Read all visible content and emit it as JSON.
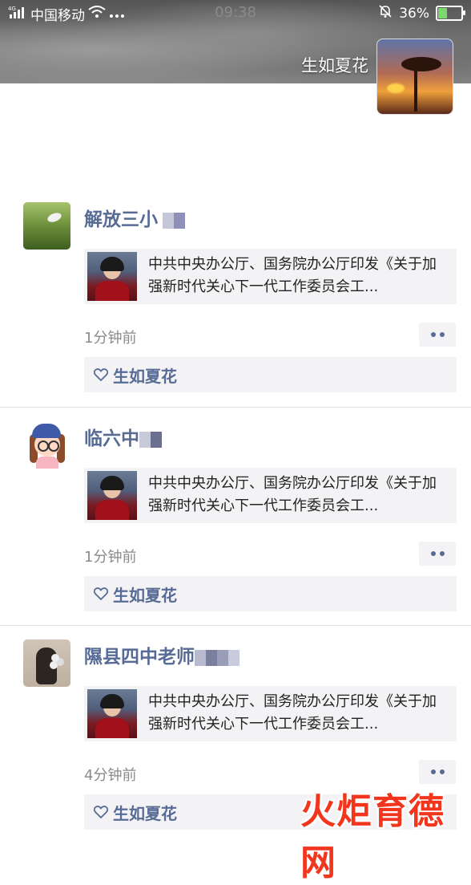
{
  "status_bar": {
    "signal_label": "4G",
    "carrier": "中国移动",
    "time": "09:38",
    "battery": "36%",
    "battery_level": 0.36,
    "icons": [
      "signal-icon",
      "wifi-icon",
      "more-dots-icon",
      "mute-bell-icon",
      "battery-icon"
    ]
  },
  "profile": {
    "name": "生如夏花"
  },
  "feed": [
    {
      "user": "解放三小",
      "share_title": "中共中央办公厅、国务院办公厅印发《关于加强新时代关心下一代工作委员会工...",
      "time": "1分钟前",
      "likes": "生如夏花"
    },
    {
      "user": "临六中",
      "share_title": "中共中央办公厅、国务院办公厅印发《关于加强新时代关心下一代工作委员会工...",
      "time": "1分钟前",
      "likes": "生如夏花"
    },
    {
      "user": "隰县四中老师",
      "share_title": "中共中央办公厅、国务院办公厅印发《关于加强新时代关心下一代工作委员会工...",
      "time": "4分钟前",
      "likes": "生如夏花"
    }
  ],
  "watermark": "火炬育德网",
  "colors": {
    "link_blue": "#576b95",
    "card_bg": "#f3f3f5",
    "watermark_red": "#f2361d"
  }
}
